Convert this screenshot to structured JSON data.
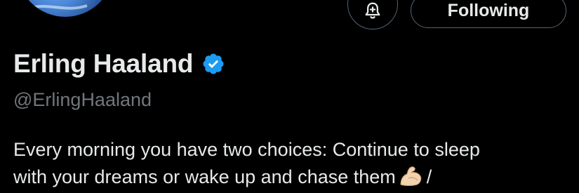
{
  "profile": {
    "display_name": "Erling Haaland",
    "handle": "@ErlingHaaland",
    "verified": true,
    "verified_color": "#1d9bf0",
    "bio_line1": "Every morning you have two choices: Continue to sleep",
    "bio_line2_pre": "with your dreams or wake up and chase them",
    "bio_emoji": "flexed-biceps",
    "bio_line2_post": "/"
  },
  "actions": {
    "notify_icon": "bell-icon",
    "follow_label": "Following"
  },
  "colors": {
    "background": "#000000",
    "text_primary": "#e7e9ea",
    "text_secondary": "#71767b",
    "button_border": "#536471"
  }
}
